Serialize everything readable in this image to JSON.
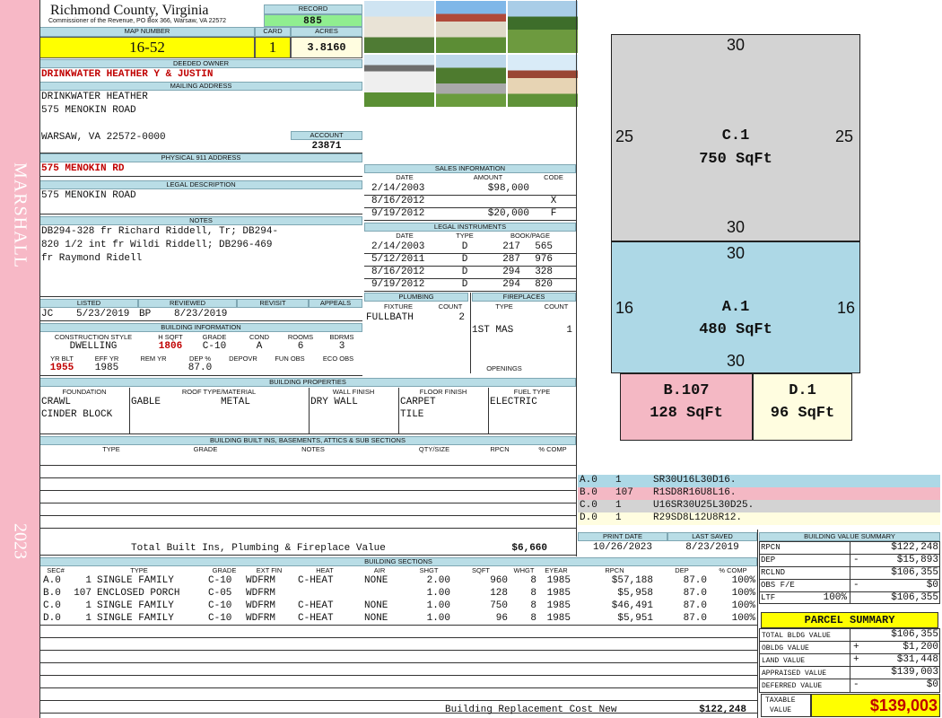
{
  "side_band": {
    "district": "MARSHALL",
    "year": "2023",
    "color": "#f7b8c6"
  },
  "header": {
    "county": "Richmond County, Virginia",
    "commissioner": "Commissioner of the Revenue, PO Box 366, Warsaw, VA 22572"
  },
  "record": {
    "label": "RECORD",
    "value": "885"
  },
  "map_number": {
    "label": "MAP NUMBER",
    "value": "16-52"
  },
  "card": {
    "label": "CARD",
    "value": "1"
  },
  "acres": {
    "label": "ACRES",
    "value": "3.8160"
  },
  "deeded_owner": {
    "label": "DEEDED OWNER",
    "value": "DRINKWATER HEATHER Y & JUSTIN"
  },
  "mailing": {
    "label": "MAILING ADDRESS",
    "line1": "DRINKWATER HEATHER",
    "line2": "575 MENOKIN ROAD",
    "line3": "WARSAW, VA 22572-0000"
  },
  "account": {
    "label": "ACCOUNT",
    "value": "23871"
  },
  "physical": {
    "label": "PHYSICAL 911 ADDRESS",
    "value": "575 MENOKIN RD"
  },
  "legal": {
    "label": "LEGAL DESCRIPTION",
    "value": "575 MENOKIN ROAD"
  },
  "notes": {
    "label": "NOTES",
    "line1": "DB294-328 fr Richard Riddell, Tr; DB294-",
    "line2": "820 1/2 int fr Wildi Riddell; DB296-469",
    "line3": "fr Raymond Ridell"
  },
  "review": {
    "listed_label": "LISTED",
    "reviewed_label": "REVIEWED",
    "revisit_label": "REVISIT",
    "appeals_label": "APPEALS",
    "listed_by": "JC",
    "listed_date": "5/23/2019",
    "reviewed_by": "BP",
    "reviewed_date": "8/23/2019"
  },
  "building_info": {
    "label": "BUILDING INFORMATION",
    "h": {
      "construction": "CONSTRUCTION STYLE",
      "hsqft": "H SQFT",
      "grade": "GRADE",
      "cond": "COND",
      "rooms": "ROOMS",
      "bdrms": "BDRMS",
      "yrblt": "YR BLT",
      "effyr": "EFF YR",
      "remyr": "REM YR",
      "dep": "DEP %",
      "depovr": "DEPOVR",
      "funobs": "FUN OBS",
      "ecoobs": "ECO OBS"
    },
    "construction": "DWELLING",
    "hsqft": "1806",
    "grade": "C-10",
    "cond": "A",
    "rooms": "6",
    "bdrms": "3",
    "yrblt": "1955",
    "effyr": "1985",
    "dep": "87.0"
  },
  "sales": {
    "label": "SALES INFORMATION",
    "h_date": "DATE",
    "h_amount": "AMOUNT",
    "h_code": "CODE",
    "rows": [
      {
        "date": "2/14/2003",
        "amount": "$98,000",
        "code": ""
      },
      {
        "date": "8/16/2012",
        "amount": "",
        "code": "X"
      },
      {
        "date": "9/19/2012",
        "amount": "$20,000",
        "code": "F"
      }
    ]
  },
  "instruments": {
    "label": "LEGAL INSTRUMENTS",
    "h_date": "DATE",
    "h_type": "TYPE",
    "h_book": "BOOK/PAGE",
    "rows": [
      {
        "date": "2/14/2003",
        "type": "D",
        "book": "217",
        "page": "565"
      },
      {
        "date": "5/12/2011",
        "type": "D",
        "book": "287",
        "page": "976"
      },
      {
        "date": "8/16/2012",
        "type": "D",
        "book": "294",
        "page": "328"
      },
      {
        "date": "9/19/2012",
        "type": "D",
        "book": "294",
        "page": "820"
      }
    ]
  },
  "plumbing": {
    "label": "PLUMBING",
    "h_fixture": "FIXTURE",
    "h_count": "COUNT",
    "fixture": "FULLBATH",
    "count": "2"
  },
  "fireplaces": {
    "label": "FIREPLACES",
    "h_type": "TYPE",
    "h_count": "COUNT",
    "type": "1ST MAS",
    "count": "1",
    "openings_label": "OPENINGS"
  },
  "properties": {
    "label": "BUILDING PROPERTIES",
    "h_foundation": "FOUNDATION",
    "h_roof": "ROOF TYPE/MATERIAL",
    "h_wall": "WALL FINISH",
    "h_floor": "FLOOR FINISH",
    "h_fuel": "FUEL TYPE",
    "foundation1": "CRAWL",
    "foundation2": "CINDER BLOCK",
    "roof_type": "GABLE",
    "roof_material": "METAL",
    "wall": "DRY WALL",
    "floor1": "CARPET",
    "floor2": "TILE",
    "fuel": "ELECTRIC"
  },
  "builtins": {
    "label": "BUILDING BUILT INS, BASEMENTS, ATTICS & SUB SECTIONS",
    "h_type": "TYPE",
    "h_grade": "GRADE",
    "h_notes": "NOTES",
    "h_qty": "QTY/SIZE",
    "h_rpcn": "RPCN",
    "h_comp": "% COMP",
    "total_label": "Total Built Ins, Plumbing & Fireplace Value",
    "total_value": "$6,660"
  },
  "print": {
    "print_label": "PRINT DATE",
    "saved_label": "LAST SAVED",
    "print_date": "10/26/2023",
    "last_saved": "8/23/2019"
  },
  "sections": {
    "label": "BUILDING SECTIONS",
    "h": {
      "sec": "SEC#",
      "type": "TYPE",
      "grade": "GRADE",
      "extfin": "EXT FIN",
      "heat": "HEAT",
      "air": "AIR",
      "shgt": "SHGT",
      "sqft": "SQFT",
      "whgt": "WHGT",
      "eyear": "EYEAR",
      "rpcn": "RPCN",
      "dep": "DEP",
      "comp": "% COMP"
    },
    "rows": [
      {
        "sec": "A.0",
        "n": "1",
        "type": "SINGLE FAMILY",
        "grade": "C-10",
        "extfin": "WDFRM",
        "heat": "C-HEAT",
        "air": "NONE",
        "shgt": "2.00",
        "sqft": "960",
        "whgt": "8",
        "eyear": "1985",
        "rpcn": "$57,188",
        "dep": "87.0",
        "comp": "100%"
      },
      {
        "sec": "B.0",
        "n": "107",
        "type": "ENCLOSED PORCH",
        "grade": "C-05",
        "extfin": "WDFRM",
        "heat": "",
        "air": "",
        "shgt": "1.00",
        "sqft": "128",
        "whgt": "8",
        "eyear": "1985",
        "rpcn": "$5,958",
        "dep": "87.0",
        "comp": "100%"
      },
      {
        "sec": "C.0",
        "n": "1",
        "type": "SINGLE FAMILY",
        "grade": "C-10",
        "extfin": "WDFRM",
        "heat": "C-HEAT",
        "air": "NONE",
        "shgt": "1.00",
        "sqft": "750",
        "whgt": "8",
        "eyear": "1985",
        "rpcn": "$46,491",
        "dep": "87.0",
        "comp": "100%"
      },
      {
        "sec": "D.0",
        "n": "1",
        "type": "SINGLE FAMILY",
        "grade": "C-10",
        "extfin": "WDFRM",
        "heat": "C-HEAT",
        "air": "NONE",
        "shgt": "1.00",
        "sqft": "96",
        "whgt": "8",
        "eyear": "1985",
        "rpcn": "$5,951",
        "dep": "87.0",
        "comp": "100%"
      }
    ],
    "rcn_label": "Building Replacement Cost New",
    "rcn_value": "$122,248"
  },
  "sketch": {
    "c1": {
      "label": "C.1",
      "area": "750 SqFt",
      "top": "30",
      "bottom": "30",
      "left": "25",
      "right": "25"
    },
    "a1": {
      "label": "A.1",
      "area": "480 SqFt",
      "top": "30",
      "bottom": "30",
      "left": "16",
      "right": "16"
    },
    "b107": {
      "label": "B.107",
      "area": "128 SqFt"
    },
    "d1": {
      "label": "D.1",
      "area": "96 SqFt"
    },
    "colors": {
      "c1": "#d3d3d3",
      "a1": "#add8e6",
      "b107": "#f4b8c4",
      "d1": "#fffde0"
    }
  },
  "legend": [
    {
      "sec": "A.0",
      "n": "1",
      "path": "SR30U16L30D16."
    },
    {
      "sec": "B.0",
      "n": "107",
      "path": "R1SD8R16U8L16."
    },
    {
      "sec": "C.0",
      "n": "1",
      "path": "U16SR30U25L30D25."
    },
    {
      "sec": "D.0",
      "n": "1",
      "path": "R29SD8L12U8R12."
    }
  ],
  "value_summary": {
    "label": "BUILDING VALUE SUMMARY",
    "rpcn_label": "RPCN",
    "rpcn": "$122,248",
    "dep_label": "DEP",
    "dep_sign": "-",
    "dep": "$15,893",
    "rclnd_label": "RCLND",
    "rclnd": "$106,355",
    "obs_label": "OBS F/E",
    "obs_sign": "-",
    "obs": "$0",
    "ltf_label": "LTF",
    "ltf_pct": "100%",
    "ltf": "$106,355"
  },
  "parcel": {
    "label": "PARCEL SUMMARY",
    "bldg_label": "TOTAL BLDG VALUE",
    "bldg": "$106,355",
    "obldg_label": "OBLDG VALUE",
    "obldg_sign": "+",
    "obldg": "$1,200",
    "land_label": "LAND VALUE",
    "land_sign": "+",
    "land": "$31,448",
    "appraised_label": "APPRAISED VALUE",
    "appraised": "$139,003",
    "deferred_label": "DEFERRED VALUE",
    "deferred_sign": "-",
    "deferred": "$0",
    "taxable_label1": "TAXABLE",
    "taxable_label2": "VALUE",
    "taxable": "$139,003"
  }
}
